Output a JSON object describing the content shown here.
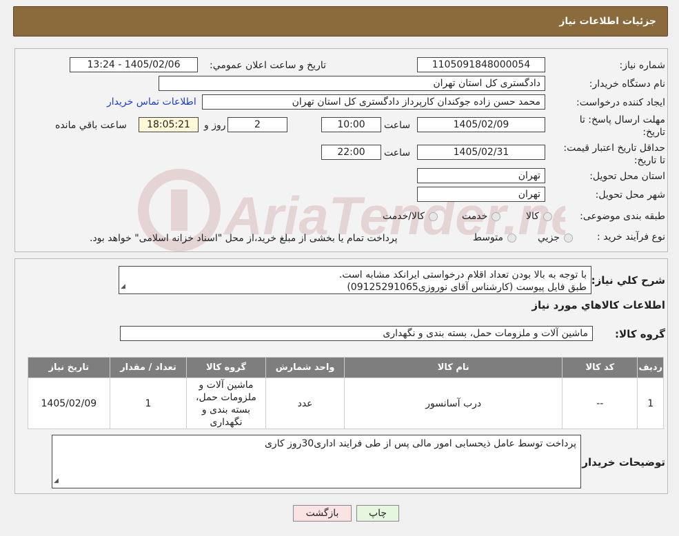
{
  "header": {
    "title": "جزئیات اطلاعات نیاز"
  },
  "watermark": {
    "text": "AriaTender.neT"
  },
  "form": {
    "need_number_label": "شماره نیاز:",
    "need_number": "1105091848000054",
    "announce_label": "تاریخ و ساعت اعلان عمومي:",
    "announce_value": "1405/02/06 - 13:24",
    "buyer_org_label": "نام دستگاه خریدار:",
    "buyer_org": "دادگستری کل استان تهران",
    "creator_label": "ایجاد کننده درخواست:",
    "creator": "محمد حسن زاده جوکندان کارپرداز دادگستری کل استان تهران",
    "contact_link": "اطلاعات تماس خریدار",
    "deadline_label": "مهلت ارسال پاسخ: تا تاریخ:",
    "deadline_date": "1405/02/09",
    "time_label": "ساعت",
    "deadline_time": "10:00",
    "days_value": "2",
    "days_label": "روز و",
    "remaining_time": "18:05:21",
    "remaining_label": "ساعت باقي مانده",
    "validity_label": "حداقل تاریخ اعتبار قیمت: تا تاریخ:",
    "validity_date": "1405/02/31",
    "validity_time": "22:00",
    "province_label": "استان محل تحویل:",
    "province": "تهران",
    "city_label": "شهر محل تحویل:",
    "city": "تهران",
    "category_label": "طبقه بندی موضوعی:",
    "category_options": [
      "کالا",
      "خدمت",
      "کالا/خدمت"
    ],
    "process_label": "نوع فرآیند خرید :",
    "process_options": [
      "جزیي",
      "متوسط"
    ],
    "process_note": "پرداخت تمام یا بخشی از مبلغ خرید،از محل \"اسناد خزانه اسلامی\" خواهد بود."
  },
  "description": {
    "label": "شرح کلي نیاز:",
    "line1": "با توجه به بالا بودن تعداد اقلام درخواستی ایرانکد مشابه است.",
    "line2": "طبق فایل پیوست (کارشناس آقای نوروزی09125291065)"
  },
  "goods": {
    "section_title": "اطلاعات کالاهاي مورد نیاز",
    "group_label": "گروه کالا:",
    "group_value": "ماشین آلات و ملزومات حمل، بسته بندی و نگهداری",
    "columns": [
      "ردیف",
      "کد کالا",
      "نام کالا",
      "واحد شمارش",
      "گروه کالا",
      "تعداد / مقدار",
      "تاریخ نیاز"
    ],
    "rows": [
      [
        "1",
        "--",
        "درب آسانسور",
        "عدد",
        "ماشین آلات و ملزومات حمل، بسته بندی و نگهداری",
        "1",
        "1405/02/09"
      ]
    ]
  },
  "buyer_notes": {
    "label": "توضیحات خریدار:",
    "text": "پرداخت توسط عامل ذیحسابی امور مالی پس از طی فرایند اداری30روز کاری"
  },
  "buttons": {
    "print": "چاپ",
    "back": "بازگشت"
  },
  "colors": {
    "header_bg": "#8b6a3c",
    "link": "#1a3cc9",
    "table_header": "#7e7e7e"
  }
}
